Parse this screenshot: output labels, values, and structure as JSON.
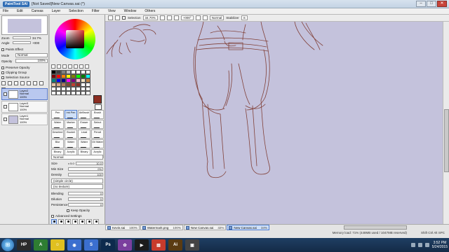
{
  "window": {
    "logo": "PaintTool SAI",
    "title": "[Not Saved]New Canvas.sai (*)",
    "min": "–",
    "max": "□",
    "close": "✕"
  },
  "menu": [
    "File",
    "Edit",
    "Canvas",
    "Layer",
    "Selection",
    "Filter",
    "View",
    "Window",
    "Others"
  ],
  "toolbar": {
    "selection_label": "Selection",
    "zoom": "34.70%",
    "rotation": "+000°",
    "blend": "Normal",
    "stabilizer_label": "Stabilizer",
    "stabilizer_value": "S"
  },
  "navigator": {
    "zoom_label": "Zoom",
    "zoom_value": "34.7%",
    "angle_label": "Angle",
    "angle_value": "+000"
  },
  "layer_panel": {
    "paper_effect": "Paints Effect",
    "mode_label": "Mode",
    "mode_value": "Normal",
    "opacity_label": "Opacity",
    "opacity_value": "100%",
    "preserve_opacity": "Preserve Opacity",
    "clipping_group": "Clipping Group",
    "selection_source": "Selection Source",
    "layers": [
      {
        "name": "Layer2",
        "mode": "Normal",
        "opacity": "100%",
        "active": true
      },
      {
        "name": "Layer3",
        "mode": "Normal",
        "opacity": "100%",
        "active": false
      },
      {
        "name": "Layer1",
        "mode": "Normal",
        "opacity": "100%",
        "active": false
      }
    ]
  },
  "swatches": [
    "#000000",
    "#404040",
    "#808080",
    "#c0c0c0",
    "#ffffff",
    "#ffffff",
    "#ffffff",
    "#ffffff",
    "#800000",
    "#ff0000",
    "#ff8000",
    "#ffff00",
    "#808000",
    "#00ff00",
    "#008000",
    "#00ffff",
    "#008080",
    "#0000ff",
    "#000080",
    "#ff00ff",
    "#800080",
    "#ffc0cb",
    "#f0e0c0",
    "#c08040",
    "#e6c3a6",
    "#d9a98a",
    "#b27a5a",
    "#7a4a32",
    "#c04030",
    "#8b2e22",
    "#ffffff",
    "#ffffff",
    "#ffffff",
    "#ffffff",
    "#ffffff",
    "#ffffff",
    "#ffffff",
    "#ffffff",
    "#ffffff",
    "#ffffff",
    "#ffffff",
    "#ffffff",
    "#ffffff",
    "#ffffff",
    "#ffffff",
    "#ffffff",
    "#ffffff",
    "#ffffff"
  ],
  "tools": [
    {
      "label": "Pen",
      "active": false
    },
    {
      "label": "Ink Pen",
      "active": true
    },
    {
      "label": "AirBrush",
      "active": false
    },
    {
      "label": "Brush",
      "active": false
    },
    {
      "label": "Water",
      "active": false
    },
    {
      "label": "Marker",
      "active": false
    },
    {
      "label": "Eraser",
      "active": false
    },
    {
      "label": "Select",
      "active": false
    },
    {
      "label": "Deselect",
      "active": false
    },
    {
      "label": "Bucket",
      "active": false
    },
    {
      "label": "Lead",
      "active": false
    },
    {
      "label": "Pencil",
      "active": false
    },
    {
      "label": "Blur",
      "active": false
    },
    {
      "label": "Water",
      "active": false
    },
    {
      "label": "Water",
      "active": false
    },
    {
      "label": "Oil Water",
      "active": false
    },
    {
      "label": "Binary",
      "active": false
    },
    {
      "label": "Acrylic",
      "active": false
    },
    {
      "label": "Binary",
      "active": false
    },
    {
      "label": "Acrylic",
      "active": false
    }
  ],
  "brush": {
    "mode": "Normal",
    "size_label": "Size",
    "size_mult": "x 5.0",
    "size_value": "10.0",
    "minsize_label": "Min Size",
    "minsize_value": "0%",
    "density_label": "Density",
    "density_value": "100",
    "shape": "(simple circle)",
    "texture": "(no texture)",
    "blending_label": "Blending",
    "blending_value": "0",
    "dilution_label": "Dilution",
    "dilution_value": "0",
    "persistence_label": "Persistence",
    "persistence_value": "0",
    "keep_opacity": "Keep Opacity",
    "advanced": "Advanced Settings"
  },
  "tabs": [
    {
      "name": "Kevin.sai",
      "pct": "100%",
      "active": false
    },
    {
      "name": "Watermark.png",
      "pct": "100%",
      "active": false
    },
    {
      "name": "New Canvas.sai",
      "pct": "32%",
      "active": false
    },
    {
      "name": "New Canvas.sai",
      "pct": "34%",
      "active": true
    }
  ],
  "status": {
    "memory": "Memory load: 71% (448MB used / 1047MB reserved)",
    "keys": "Shift Ctrl Alt SPC"
  },
  "clock": {
    "time": "3:52 PM",
    "date": "5/24/2015"
  },
  "taskbar_apps": [
    {
      "label": "HP",
      "color": "#2b2b2b"
    },
    {
      "label": "A",
      "color": "#2e7d32"
    },
    {
      "label": "☺",
      "color": "#e0c020"
    },
    {
      "label": "◉",
      "color": "#3b6fcf"
    },
    {
      "label": "S",
      "color": "#3b6fcf"
    },
    {
      "label": "Ps",
      "color": "#0d2a4d"
    },
    {
      "label": "✿",
      "color": "#7b3f9e"
    },
    {
      "label": "▶",
      "color": "#1b1b1b"
    },
    {
      "label": "▤",
      "color": "#c73b2c"
    },
    {
      "label": "Ai",
      "color": "#5a3b12"
    },
    {
      "label": "▣",
      "color": "#444444"
    }
  ]
}
